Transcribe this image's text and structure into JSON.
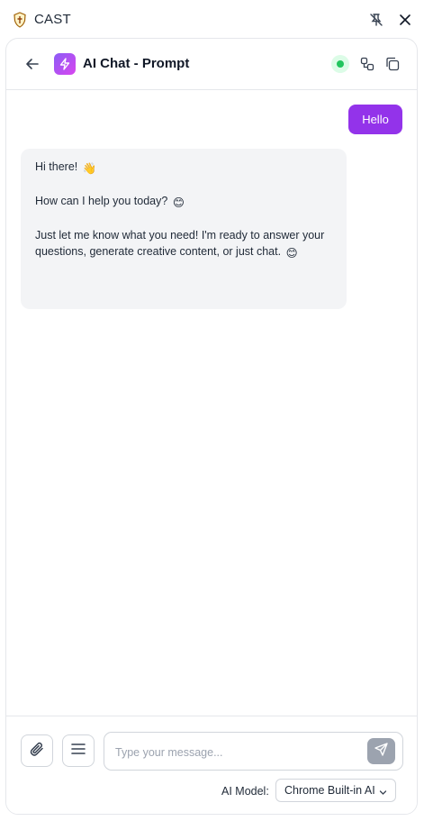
{
  "window": {
    "title": "CAST",
    "logo_icon": "shield-logo-icon",
    "pin_icon": "pin-off-icon",
    "close_icon": "close-icon"
  },
  "header": {
    "back_icon": "arrow-left-icon",
    "app_icon": "lightning-icon",
    "title": "AI Chat - Prompt",
    "status": "online",
    "status_color": "#22c55e",
    "flow_icon": "flow-icon",
    "copy_icon": "copy-icon"
  },
  "messages": [
    {
      "role": "user",
      "text": "Hello"
    },
    {
      "role": "assistant",
      "line1": "Hi there!",
      "line1_emoji": "👋",
      "line2": "How can I help you today?",
      "line2_emoji": "😊",
      "line3": "Just let me know what you need! I'm ready to answer your",
      "line4": "questions, generate creative content, or just chat.",
      "line4_emoji": "😊"
    }
  ],
  "composer": {
    "attach_icon": "paperclip-icon",
    "menu_icon": "menu-icon",
    "placeholder": "Type your message...",
    "value": "",
    "send_icon": "send-icon"
  },
  "model": {
    "label": "AI Model:",
    "selected": "Chrome Built-in AI",
    "chevron_icon": "chevron-down-icon"
  },
  "colors": {
    "accent": "#9333ea",
    "assistant_bubble": "#f3f4f6",
    "send_disabled": "#9ca3af"
  }
}
